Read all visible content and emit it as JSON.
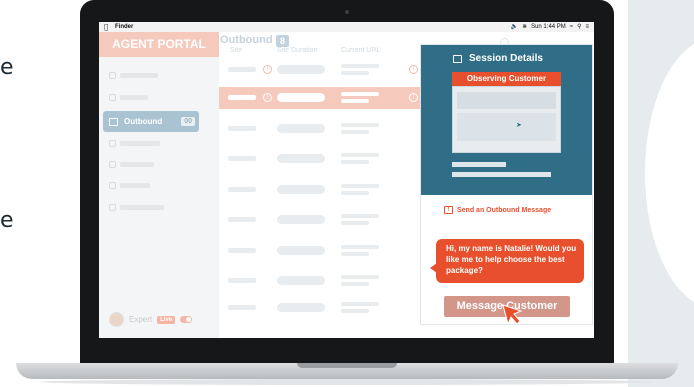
{
  "menubar": {
    "app_name": "Finder",
    "apple_icon": "apple-icon",
    "time": "Sun 1:44 PM",
    "status_icons": [
      "volume-icon",
      "bluetooth-icon",
      "wifi-icon",
      "search-icon",
      "menu-list-icon"
    ]
  },
  "sidebar": {
    "brand": "AGENT PORTAL",
    "active_item": {
      "label": "Outbound",
      "count": "00",
      "icon": "outbound-icon"
    },
    "footer": {
      "user_label": "Expert",
      "status_badge": "Live"
    }
  },
  "main": {
    "title": "Outbound",
    "count": "8",
    "columns": [
      "Site",
      "Site Duration",
      "Current URL"
    ],
    "highlighted_row_index": 1
  },
  "session": {
    "title": "Session Details",
    "observing_label": "Observing Customer",
    "send_link": "Send an Outbound Message",
    "chat_message": "Hi, my name is Natalie! Would you like me to help choose the best package?",
    "button_label": "Message Customer"
  },
  "colors": {
    "brand_salmon": "#f6c9bd",
    "accent_orange": "#e8502d",
    "panel_teal": "#2f6e86",
    "button_muted": "#d3978a"
  }
}
